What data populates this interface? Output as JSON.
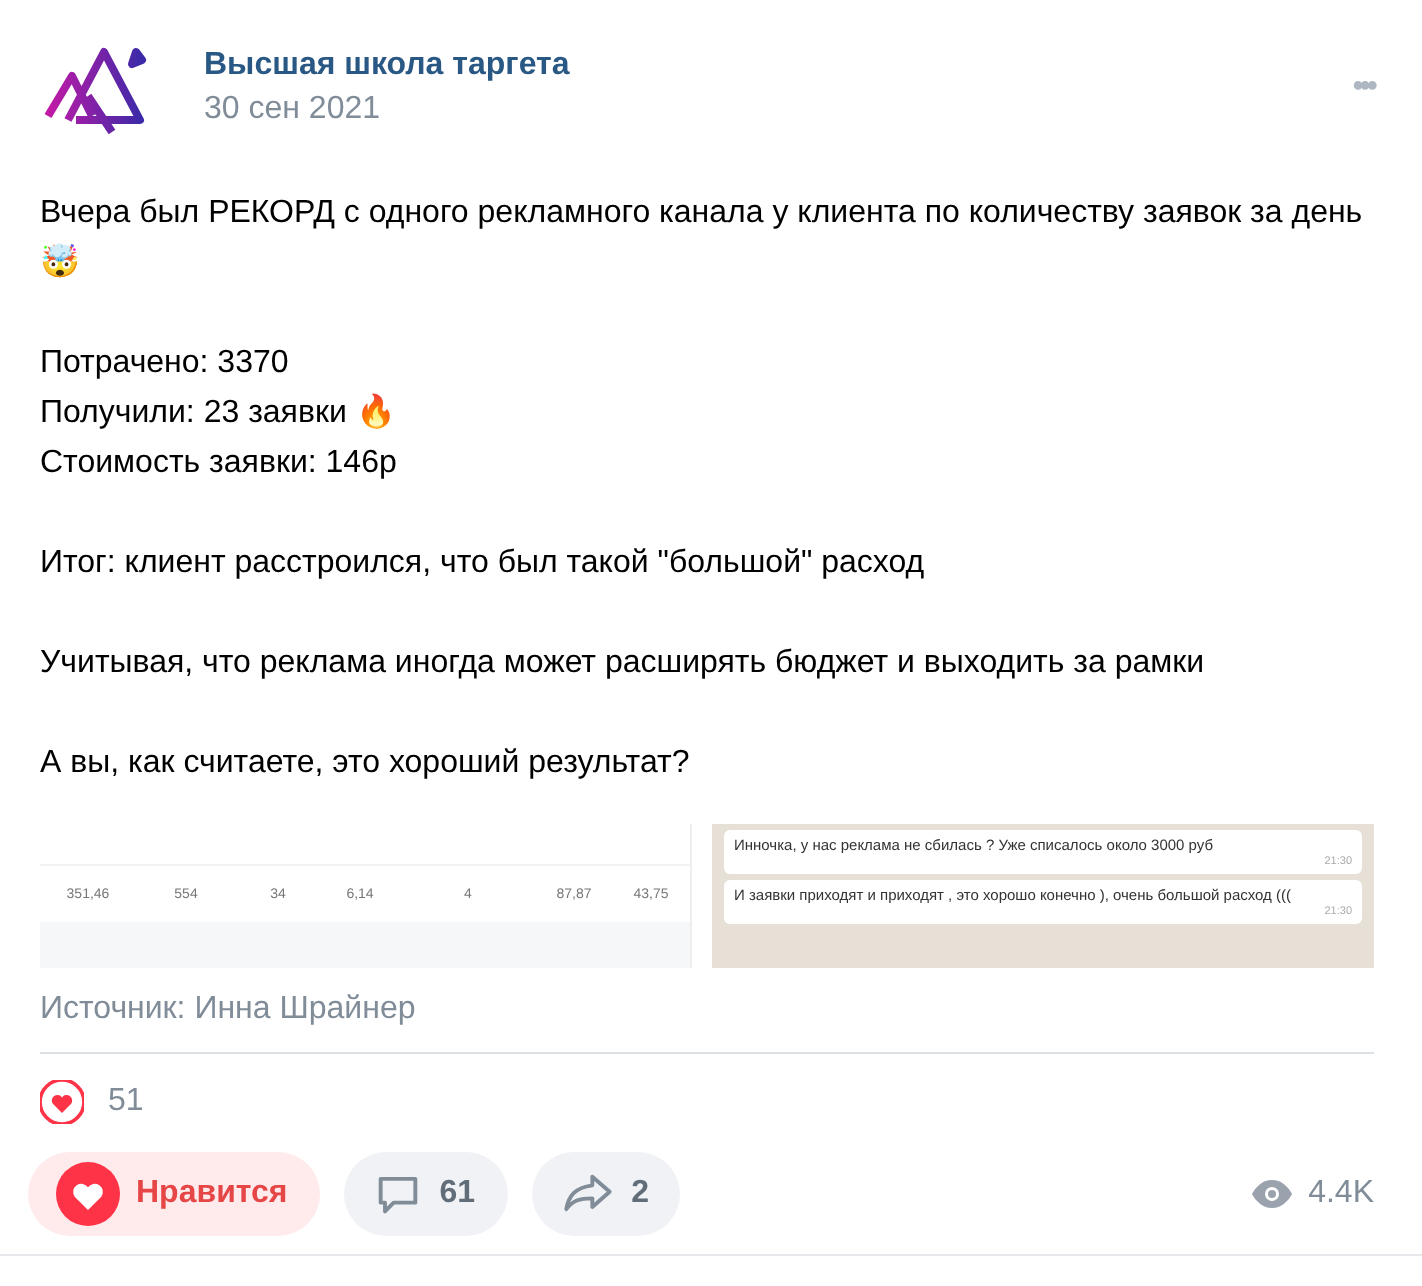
{
  "post": {
    "author": "Высшая школа таргета",
    "date": "30 сен 2021",
    "menu": "•••",
    "paragraphs": [
      [
        "Вчера был РЕКОРД с одного рекламного канала у клиента по количеству заявок за день 🤯"
      ],
      [
        "Потрачено: 3370",
        "Получили: 23 заявки 🔥",
        "Стоимость заявки: 146р"
      ],
      [
        "Итог: клиент расстроился, что был такой \"большой\" расход"
      ],
      [
        "Учитывая, что реклама иногда может расширять бюджет и выходить за рамки"
      ],
      [
        "А вы, как считаете, это хороший результат?"
      ]
    ],
    "attachments": [
      {
        "kind": "table",
        "rows": [
          [
            "351,46",
            "554",
            "34",
            "6,14",
            "4",
            "87,87",
            "43,75"
          ]
        ]
      },
      {
        "kind": "chat",
        "messages": [
          {
            "text": "Инночка, у нас реклама не сбилась ? Уже списалось около 3000 руб",
            "time": "21:30"
          },
          {
            "text": "И заявки приходят и приходят , это хорошо конечно ), очень большой расход (((",
            "time": "21:30"
          }
        ]
      }
    ],
    "source": "Источник: Инна Шрайнер",
    "likes_count": "51",
    "actions": [
      {
        "kind": "like",
        "label": "Нравится",
        "selected": true
      },
      {
        "kind": "comment",
        "label": "61"
      },
      {
        "kind": "share",
        "label": "2"
      }
    ],
    "views": "4.4K"
  }
}
